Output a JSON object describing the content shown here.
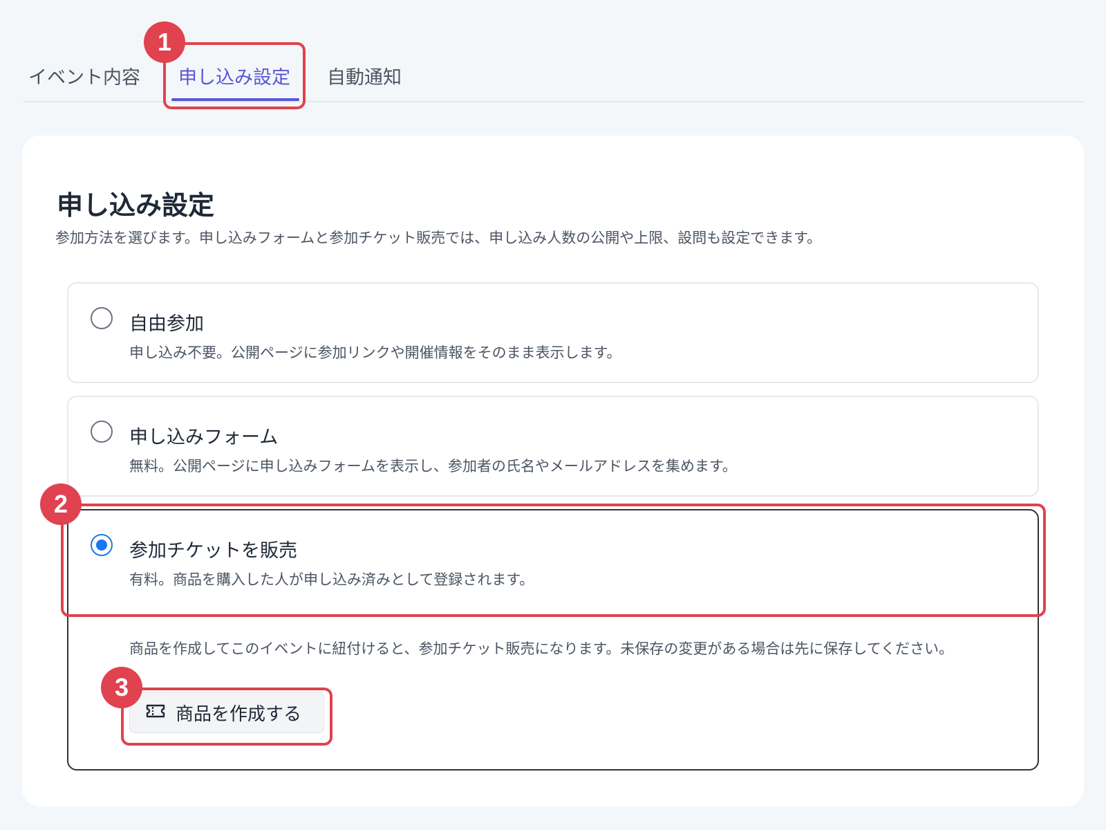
{
  "tabs": {
    "items": [
      {
        "label": "イベント内容"
      },
      {
        "label": "申し込み設定"
      },
      {
        "label": "自動通知"
      }
    ],
    "active_index": 1
  },
  "card": {
    "title": "申し込み設定",
    "description": "参加方法を選びます。申し込みフォームと参加チケット販売では、申し込み人数の公開や上限、設問も設定できます。"
  },
  "options": [
    {
      "label": "自由参加",
      "description": "申し込み不要。公開ページに参加リンクや開催情報をそのまま表示します。",
      "selected": false
    },
    {
      "label": "申し込みフォーム",
      "description": "無料。公開ページに申し込みフォームを表示し、参加者の氏名やメールアドレスを集めます。",
      "selected": false
    },
    {
      "label": "参加チケットを販売",
      "description": "有料。商品を購入した人が申し込み済みとして登録されます。",
      "selected": true,
      "note": "商品を作成してこのイベントに紐付けると、参加チケット販売になります。未保存の変更がある場合は先に保存してください。",
      "button_label": "商品を作成する",
      "button_icon": "ticket-icon"
    }
  ],
  "annotations": {
    "badges": [
      "1",
      "2",
      "3"
    ],
    "color": "#e0424f"
  },
  "colors": {
    "accent": "#5856d6",
    "radio_selected": "#1877f2"
  }
}
